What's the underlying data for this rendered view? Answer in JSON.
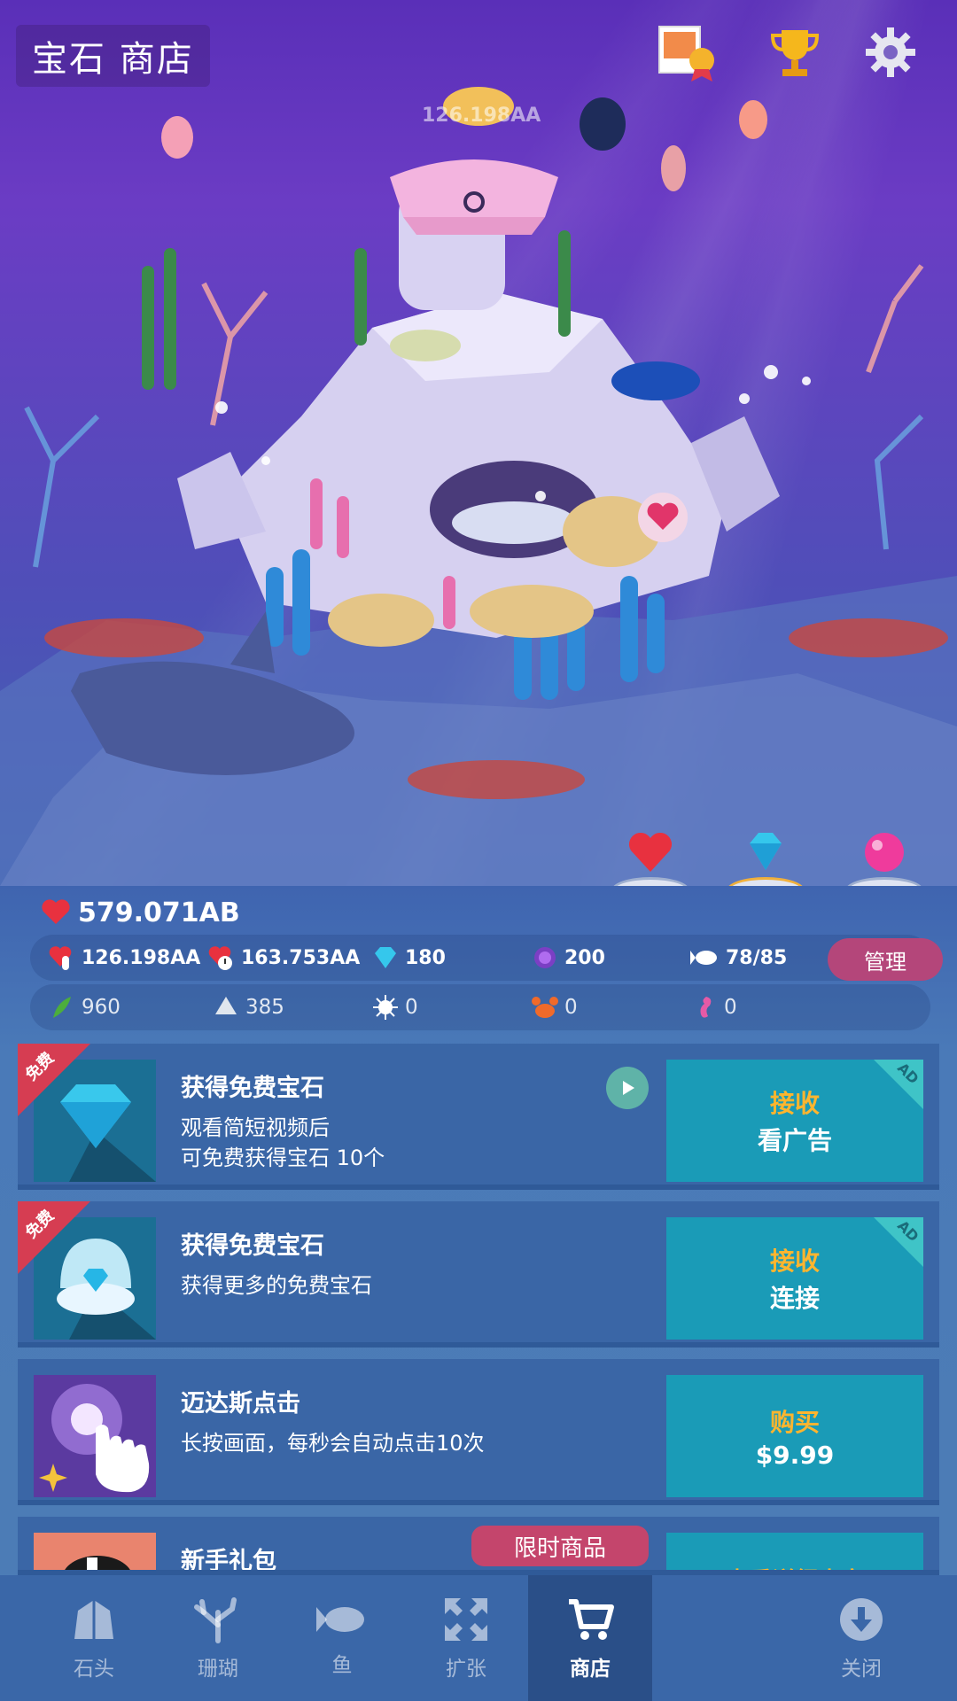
{
  "header": {
    "title": "宝石 商店",
    "floating_value": "126.198AA"
  },
  "top_icons": [
    "album-award-icon",
    "trophy-icon",
    "gear-icon"
  ],
  "stats": {
    "hearts": "579.071AB",
    "per_tap": "126.198AA",
    "per_sec": "163.753AA",
    "gems": "180",
    "pearls": "200",
    "fish_count": "78/85",
    "manage_label": "管理",
    "seaweed": "960",
    "shell": "385",
    "urchin": "0",
    "crab": "0",
    "seahorse": "0"
  },
  "shop": [
    {
      "tag": "免费",
      "title": "获得免费宝石",
      "desc": "观看简短视频后\n可免费获得宝石 10个",
      "action1": "接收",
      "action2": "看广告",
      "ad": "AD"
    },
    {
      "tag": "免费",
      "title": "获得免费宝石",
      "desc": "获得更多的免费宝石",
      "action1": "接收",
      "action2": "连接",
      "ad": "AD"
    },
    {
      "title": "迈达斯点击",
      "desc": "长按画面，每秒会自动点击10次",
      "action1": "购买",
      "action2": "$9.99"
    },
    {
      "title": "新手礼包",
      "badge": "限时商品",
      "action1": "查看详细内容"
    }
  ],
  "nav": {
    "items": [
      {
        "label": "石头",
        "icon": "rock-icon"
      },
      {
        "label": "珊瑚",
        "icon": "coral-icon"
      },
      {
        "label": "鱼",
        "icon": "fish-icon"
      },
      {
        "label": "扩张",
        "icon": "expand-icon"
      },
      {
        "label": "商店",
        "icon": "cart-icon",
        "active": true
      },
      {
        "label": "关闭",
        "icon": "close-down-icon"
      }
    ]
  },
  "colors": {
    "accent_orange": "#ffb52e",
    "action_teal": "#1a9bb7",
    "free_red": "#d63d52",
    "manage_pink": "#b4467a"
  }
}
